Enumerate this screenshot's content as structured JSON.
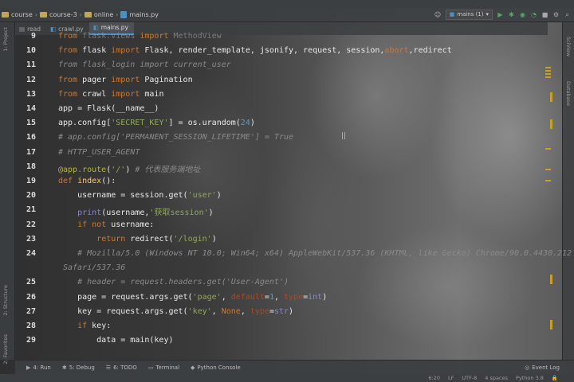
{
  "navbar": {
    "breadcrumb": [
      "course",
      "course-3",
      "online",
      "mains.py"
    ],
    "run_config": "mains (1)"
  },
  "tabs": [
    {
      "label": "read"
    },
    {
      "label": "crawl.py"
    },
    {
      "label": "mains.py",
      "active": true
    }
  ],
  "left_tool_windows": [
    "1: Project",
    "2: Structure",
    "2: Favorites"
  ],
  "right_tool_windows": [
    "SciView",
    "Database"
  ],
  "code_lines": [
    {
      "num": "9",
      "html": "<span class=\"kw\">from</span> flask.views <span class=\"kw\">import</span> MethodView",
      "dim": true
    },
    {
      "num": "10",
      "html": "<span class=\"kw\">from</span> flask <span class=\"kw\">import</span> Flask, render_template, jsonify, request, session,<span class=\"kw\">abort</span>,redirect"
    },
    {
      "num": "11",
      "html": "<span class=\"cm\">from flask_login import current_user</span>"
    },
    {
      "num": "12",
      "html": "<span class=\"kw\">from</span> pager <span class=\"kw\">import</span> Pagination"
    },
    {
      "num": "13",
      "html": "<span class=\"kw\">from</span> crawl <span class=\"kw\">import</span> main"
    },
    {
      "num": "14",
      "html": "app = Flask(__name__)"
    },
    {
      "num": "15",
      "html": "app.config[<span class=\"str\">'SECRET_KEY'</span>] = os.urandom(<span class=\"num\">24</span>)"
    },
    {
      "num": "16",
      "html": "<span class=\"cm\"># app.config['PERMANENT_SESSION_LIFETIME'] = True</span>"
    },
    {
      "num": "17",
      "html": "<span class=\"cm\"># HTTP_USER_AGENT</span>"
    },
    {
      "num": "18",
      "html": "<span class=\"dec\">@app.route</span>(<span class=\"str\">'/'</span>) <span class=\"cm\"># 代表服务端地址</span>"
    },
    {
      "num": "19",
      "html": "<span class=\"kw\">def</span> <span class=\"fn\">index</span>():"
    },
    {
      "num": "20",
      "html": "    username = session.get(<span class=\"str\">'user'</span>)"
    },
    {
      "num": "21",
      "html": "    <span class=\"bi\">print</span>(username,<span class=\"str\">'获取session'</span>)"
    },
    {
      "num": "22",
      "html": "    <span class=\"kw\">if not</span> username:"
    },
    {
      "num": "23",
      "html": "        <span class=\"kw\">return</span> redirect(<span class=\"str\">'/login'</span>)"
    },
    {
      "num": "24",
      "html": "    <span class=\"cm\"># Mozilla/5.0 (Windows NT 10.0; Win64; x64) AppleWebKit/537.36 (KHTML, like Gecko) Chrome/90.0.4430.212</span>"
    },
    {
      "num": "",
      "html": "<span class=\"cm\">Safari/537.36</span>",
      "wrap": true
    },
    {
      "num": "25",
      "html": "    <span class=\"cm\"># header = request.headers.get('User-Agent')</span>"
    },
    {
      "num": "26",
      "html": "    page = request.args.get(<span class=\"str\">'page'</span>, <span class=\"param\">default</span>=<span class=\"num\">1</span>, <span class=\"param\">type</span>=<span class=\"bi\">int</span>)"
    },
    {
      "num": "27",
      "html": "    key = request.args.get(<span class=\"str\">'key'</span>, <span class=\"kw\">None</span>, <span class=\"param\">type</span>=<span class=\"bi\">str</span>)"
    },
    {
      "num": "28",
      "html": "    <span class=\"kw\">if</span> key:"
    },
    {
      "num": "29",
      "html": "        data = main(key)"
    }
  ],
  "tool_windows": [
    {
      "icon": "▶",
      "label": "4: Run"
    },
    {
      "icon": "✱",
      "label": "5: Debug"
    },
    {
      "icon": "☰",
      "label": "6: TODO"
    },
    {
      "icon": "▭",
      "label": "Terminal"
    },
    {
      "icon": "◆",
      "label": "Python Console"
    }
  ],
  "event_log": "Event Log",
  "status": {
    "position": "6:20",
    "line_sep": "LF",
    "encoding": "UTF-8",
    "indent": "4 spaces",
    "interpreter": "Python 3.8"
  },
  "colors": {
    "keyword": "#cc7832",
    "string": "#8fa85c",
    "comment": "#8a8a8a",
    "function": "#ffc66d",
    "builtin": "#8888c6"
  }
}
